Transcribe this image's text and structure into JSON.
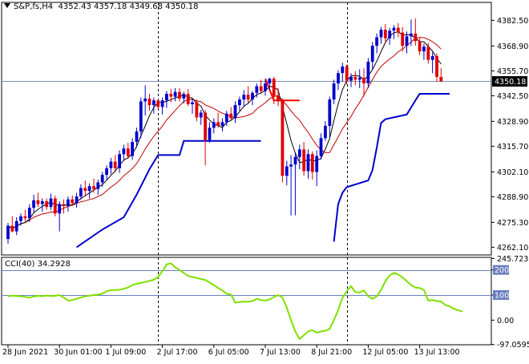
{
  "header": {
    "symbol": "S&P,fs,H4",
    "ohlc": "4352.43 4357.18 4349.68 4350.18"
  },
  "price_label": "4350.18",
  "cci_header": {
    "name": "CCI(40)",
    "value": "34.2928"
  },
  "colors": {
    "bull": "#0000CD",
    "bear": "#E00000",
    "ma_fast": "#000000",
    "ma_slow": "#C00000",
    "trail_line": "#0000CD",
    "cci": "#7FE000",
    "marker": "#FF0000",
    "level_line": "#6A7FC0"
  },
  "chart_data": [
    {
      "type": "candlestick",
      "title": "S&P,fs,H4",
      "ylim": [
        4258.0,
        4392.0
      ],
      "y_ticks": [
        "4382.50",
        "4368.90",
        "4355.70",
        "4342.50",
        "4328.90",
        "4315.70",
        "4302.10",
        "4288.90",
        "4275.30",
        "4262.10"
      ],
      "x_labels": [
        "28 Jun 2021",
        "30 Jun 01:00",
        "1 Jul 09:00",
        "2 Jul 17:00",
        "6 Jul 05:00",
        "7 Jul 13:00",
        "8 Jul 21:00",
        "12 Jul 05:00",
        "13 Jul 13:00"
      ],
      "x_label_bars": [
        0,
        12,
        24,
        36,
        48,
        60,
        72,
        84,
        96
      ],
      "day_separators": [
        35,
        79
      ],
      "current_price": 4350.18,
      "candles": [
        [
          4266.5,
          4275.0,
          4264.0,
          4273.5
        ],
        [
          4273.5,
          4278.5,
          4270.0,
          4270.5
        ],
        [
          4270.5,
          4278.0,
          4268.5,
          4276.0
        ],
        [
          4276.0,
          4280.0,
          4273.5,
          4278.5
        ],
        [
          4278.5,
          4282.0,
          4275.5,
          4277.5
        ],
        [
          4277.5,
          4285.0,
          4275.5,
          4283.0
        ],
        [
          4283.0,
          4290.0,
          4280.5,
          4287.0
        ],
        [
          4287.0,
          4291.0,
          4283.5,
          4285.0
        ],
        [
          4285.0,
          4288.0,
          4281.0,
          4286.5
        ],
        [
          4286.5,
          4288.0,
          4282.0,
          4283.5
        ],
        [
          4283.5,
          4290.5,
          4282.0,
          4288.0
        ],
        [
          4288.0,
          4289.5,
          4278.5,
          4280.0
        ],
        [
          4280.0,
          4286.5,
          4270.5,
          4285.0
        ],
        [
          4285.0,
          4287.5,
          4280.0,
          4284.0
        ],
        [
          4284.0,
          4289.0,
          4281.0,
          4287.5
        ],
        [
          4287.5,
          4289.5,
          4284.0,
          4285.5
        ],
        [
          4285.5,
          4291.0,
          4283.0,
          4289.0
        ],
        [
          4289.0,
          4295.5,
          4287.5,
          4293.5
        ],
        [
          4293.5,
          4297.5,
          4289.0,
          4292.0
        ],
        [
          4292.0,
          4296.0,
          4288.0,
          4294.5
        ],
        [
          4294.5,
          4298.5,
          4291.0,
          4293.0
        ],
        [
          4293.0,
          4298.0,
          4290.0,
          4296.5
        ],
        [
          4296.5,
          4302.0,
          4294.0,
          4300.5
        ],
        [
          4300.5,
          4305.5,
          4298.0,
          4304.0
        ],
        [
          4304.0,
          4309.5,
          4301.0,
          4307.5
        ],
        [
          4307.5,
          4311.0,
          4302.0,
          4304.0
        ],
        [
          4304.0,
          4313.5,
          4301.5,
          4311.5
        ],
        [
          4311.5,
          4316.5,
          4308.5,
          4314.5
        ],
        [
          4314.5,
          4317.5,
          4309.0,
          4310.5
        ],
        [
          4310.5,
          4320.0,
          4308.5,
          4318.0
        ],
        [
          4318.0,
          4325.5,
          4315.0,
          4323.5
        ],
        [
          4323.5,
          4341.5,
          4320.0,
          4339.5
        ],
        [
          4339.5,
          4348.0,
          4332.0,
          4341.0
        ],
        [
          4341.0,
          4343.5,
          4334.5,
          4337.5
        ],
        [
          4337.5,
          4341.5,
          4333.0,
          4340.0
        ],
        [
          4340.0,
          4340.5,
          4335.5,
          4336.5
        ],
        [
          4336.5,
          4341.5,
          4332.5,
          4340.0
        ],
        [
          4340.0,
          4345.0,
          4336.0,
          4343.5
        ],
        [
          4343.5,
          4346.0,
          4339.0,
          4342.0
        ],
        [
          4342.0,
          4346.5,
          4339.5,
          4344.5
        ],
        [
          4344.5,
          4346.5,
          4339.5,
          4341.0
        ],
        [
          4341.0,
          4344.5,
          4338.5,
          4343.5
        ],
        [
          4343.5,
          4346.0,
          4337.0,
          4338.0
        ],
        [
          4338.0,
          4341.0,
          4333.0,
          4339.0
        ],
        [
          4339.0,
          4340.5,
          4329.0,
          4331.0
        ],
        [
          4331.0,
          4335.0,
          4327.0,
          4333.5
        ],
        [
          4333.5,
          4335.0,
          4305.5,
          4319.0
        ],
        [
          4319.0,
          4328.5,
          4317.5,
          4325.5
        ],
        [
          4325.5,
          4330.5,
          4322.5,
          4328.5
        ],
        [
          4328.5,
          4333.5,
          4325.5,
          4326.5
        ],
        [
          4326.5,
          4330.5,
          4323.5,
          4328.5
        ],
        [
          4328.5,
          4334.5,
          4326.5,
          4333.0
        ],
        [
          4333.0,
          4336.5,
          4329.5,
          4330.5
        ],
        [
          4330.5,
          4339.5,
          4328.0,
          4337.5
        ],
        [
          4337.5,
          4342.0,
          4334.5,
          4340.5
        ],
        [
          4340.5,
          4345.5,
          4336.5,
          4343.0
        ],
        [
          4343.0,
          4347.5,
          4338.5,
          4340.5
        ],
        [
          4340.5,
          4345.0,
          4337.5,
          4344.0
        ],
        [
          4344.0,
          4349.0,
          4341.5,
          4347.5
        ],
        [
          4347.5,
          4351.0,
          4343.5,
          4345.0
        ],
        [
          4345.0,
          4351.0,
          4342.5,
          4349.0
        ],
        [
          4349.0,
          4352.0,
          4345.5,
          4351.5
        ],
        [
          4351.5,
          4352.5,
          4338.0,
          4342.5
        ],
        [
          4342.5,
          4346.5,
          4337.0,
          4339.5
        ],
        [
          4339.5,
          4341.0,
          4296.5,
          4300.0
        ],
        [
          4300.0,
          4308.0,
          4295.0,
          4305.0
        ],
        [
          4305.0,
          4311.0,
          4279.0,
          4306.0
        ],
        [
          4306.0,
          4312.5,
          4279.0,
          4310.0
        ],
        [
          4310.0,
          4316.5,
          4303.5,
          4314.0
        ],
        [
          4314.0,
          4318.0,
          4300.0,
          4302.5
        ],
        [
          4302.5,
          4314.0,
          4298.5,
          4311.5
        ],
        [
          4311.5,
          4313.0,
          4298.0,
          4302.0
        ],
        [
          4302.0,
          4313.5,
          4294.5,
          4310.5
        ],
        [
          4310.5,
          4322.5,
          4308.5,
          4320.0
        ],
        [
          4320.0,
          4329.0,
          4318.5,
          4326.5
        ],
        [
          4326.5,
          4342.0,
          4320.5,
          4340.5
        ],
        [
          4340.5,
          4351.0,
          4338.0,
          4349.0
        ],
        [
          4349.0,
          4356.0,
          4345.5,
          4354.5
        ],
        [
          4354.5,
          4360.0,
          4350.0,
          4358.0
        ],
        [
          4358.0,
          4359.0,
          4348.5,
          4350.5
        ],
        [
          4350.5,
          4354.5,
          4347.0,
          4352.5
        ],
        [
          4352.5,
          4355.5,
          4348.0,
          4351.0
        ],
        [
          4351.0,
          4356.5,
          4346.5,
          4352.0
        ],
        [
          4352.0,
          4357.0,
          4342.0,
          4349.0
        ],
        [
          4349.0,
          4362.5,
          4346.5,
          4360.5
        ],
        [
          4360.5,
          4371.0,
          4356.5,
          4369.0
        ],
        [
          4369.0,
          4375.5,
          4365.0,
          4373.5
        ],
        [
          4373.5,
          4379.0,
          4370.0,
          4377.5
        ],
        [
          4377.5,
          4380.5,
          4370.5,
          4373.0
        ],
        [
          4373.0,
          4378.5,
          4369.5,
          4377.0
        ],
        [
          4377.0,
          4380.0,
          4372.5,
          4378.5
        ],
        [
          4378.5,
          4381.0,
          4373.5,
          4376.0
        ],
        [
          4376.0,
          4379.0,
          4366.0,
          4369.0
        ],
        [
          4369.0,
          4376.5,
          4365.0,
          4374.0
        ],
        [
          4374.0,
          4383.0,
          4369.0,
          4375.5
        ],
        [
          4375.5,
          4383.5,
          4369.0,
          4371.5
        ],
        [
          4371.5,
          4373.0,
          4364.0,
          4366.0
        ],
        [
          4366.0,
          4370.0,
          4361.5,
          4368.5
        ],
        [
          4368.5,
          4370.5,
          4359.5,
          4361.5
        ],
        [
          4361.5,
          4365.5,
          4354.5,
          4363.5
        ],
        [
          4363.5,
          4365.0,
          4350.0,
          4352.5
        ],
        [
          4352.43,
          4357.18,
          4349.68,
          4350.18
        ]
      ],
      "trail_segments": [
        {
          "points": [
            [
              16,
              4262.1
            ],
            [
              22,
              4271.5
            ],
            [
              27,
              4278.0
            ],
            [
              30,
              4290.0
            ],
            [
              33,
              4303.5
            ],
            [
              35,
              4311.0
            ],
            [
              40,
              4311.0
            ],
            [
              41,
              4318.5
            ],
            [
              59,
              4318.5
            ]
          ]
        },
        {
          "points": [
            [
              76,
              4265.0
            ],
            [
              77,
              4285.0
            ],
            [
              78,
              4291.0
            ],
            [
              79,
              4294.0
            ],
            [
              84,
              4297.5
            ],
            [
              85,
              4303.0
            ],
            [
              86,
              4315.0
            ],
            [
              87,
              4328.0
            ],
            [
              88,
              4330.0
            ],
            [
              93,
              4332.5
            ],
            [
              95,
              4340.0
            ],
            [
              96,
              4343.5
            ],
            [
              103,
              4343.5
            ]
          ]
        }
      ],
      "marker_polyline": [
        [
          60,
          4351.5
        ],
        [
          62,
          4340.0
        ],
        [
          68,
          4340.0
        ]
      ]
    },
    {
      "type": "line",
      "title": "CCI(40)",
      "ylim": [
        -98.0,
        250.0
      ],
      "y_ticks": [
        "245.7235",
        "200",
        "100",
        "0.00",
        "-97.0595"
      ],
      "levels": [
        200,
        100
      ],
      "values": [
        95,
        98,
        96,
        95,
        93,
        90,
        94,
        97,
        95,
        98,
        96,
        97,
        100,
        90,
        78,
        80,
        85,
        90,
        95,
        97,
        100,
        102,
        105,
        115,
        120,
        120,
        121,
        125,
        130,
        140,
        145,
        148,
        152,
        156,
        161,
        172,
        195,
        222,
        226,
        210,
        200,
        188,
        176,
        172,
        168,
        164,
        160,
        150,
        140,
        128,
        118,
        105,
        102,
        70,
        72,
        74,
        73,
        76,
        85,
        80,
        78,
        82,
        92,
        100,
        90,
        50,
        0,
        -45,
        -75,
        -60,
        -45,
        -40,
        -50,
        -45,
        -42,
        -35,
        0,
        40,
        90,
        115,
        135,
        112,
        110,
        118,
        95,
        85,
        95,
        120,
        155,
        178,
        188,
        182,
        170,
        155,
        140,
        130,
        128,
        120,
        78,
        80,
        76,
        74,
        60,
        55,
        45,
        39,
        34.29
      ]
    }
  ]
}
